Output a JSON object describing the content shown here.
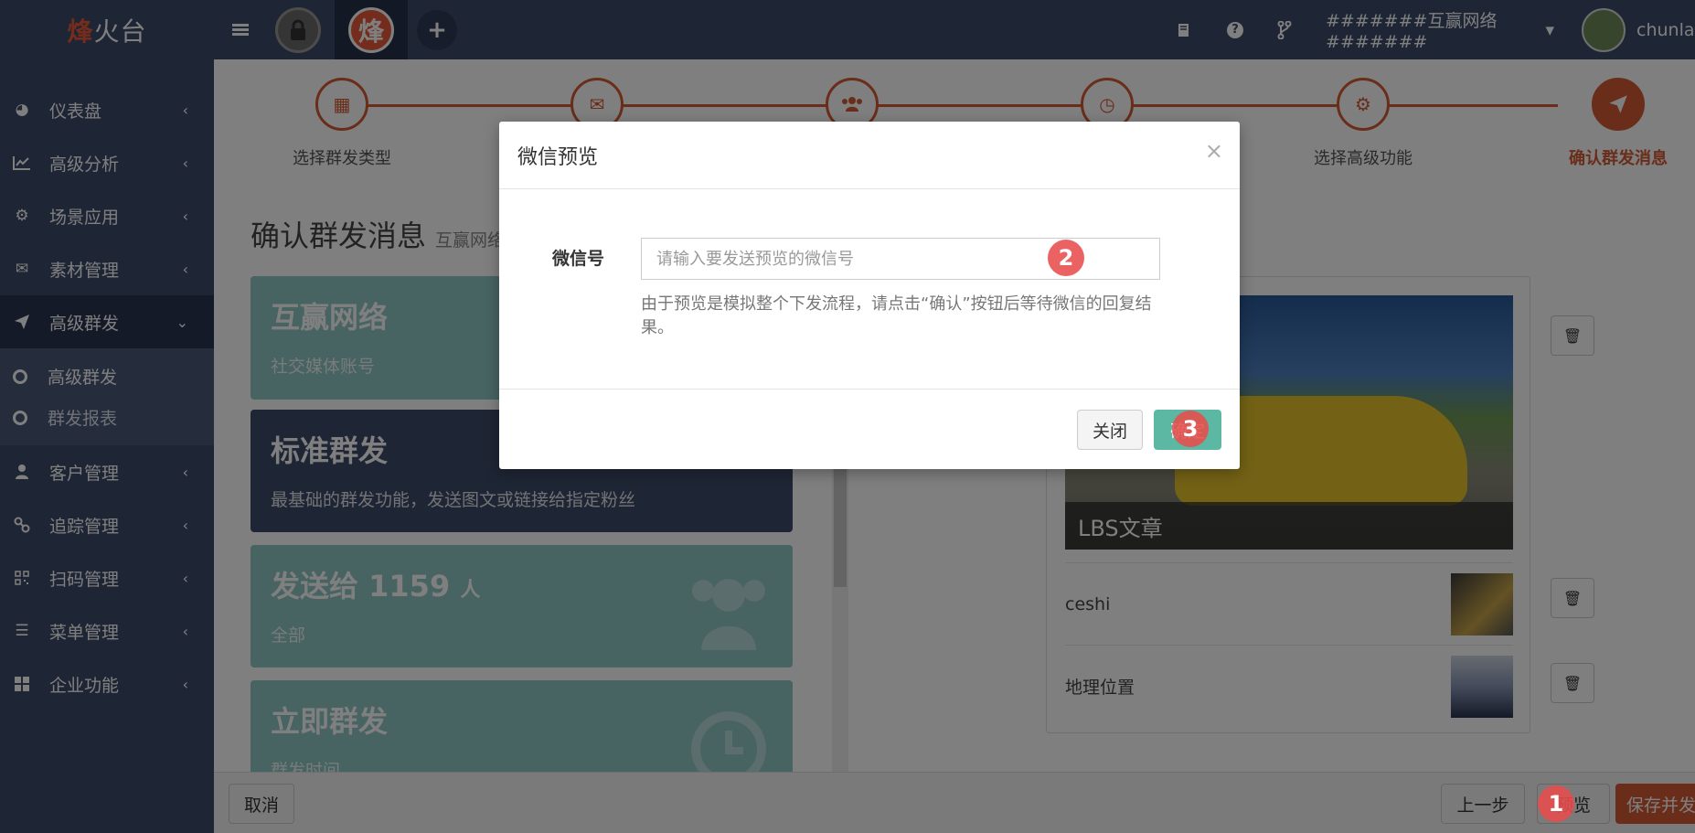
{
  "logo": {
    "part1": "烽",
    "part2": "火台"
  },
  "topbar": {
    "active_account_glyph": "烽",
    "add_glyph": "+",
    "account_menu": "#######互赢网络#######",
    "user_name": "chunlan",
    "icons": [
      "menu-icon",
      "book-icon",
      "help-icon",
      "branch-icon",
      "caret-down-icon"
    ]
  },
  "sidebar": {
    "items": [
      {
        "label": "仪表盘",
        "icon": "dashboard-icon"
      },
      {
        "label": "高级分析",
        "icon": "line-chart-icon"
      },
      {
        "label": "场景应用",
        "icon": "gear-icon"
      },
      {
        "label": "素材管理",
        "icon": "envelope-icon"
      },
      {
        "label": "高级群发",
        "icon": "send-icon"
      },
      {
        "label": "客户管理",
        "icon": "user-icon"
      },
      {
        "label": "追踪管理",
        "icon": "link-icon"
      },
      {
        "label": "扫码管理",
        "icon": "qrcode-icon"
      },
      {
        "label": "菜单管理",
        "icon": "list-icon"
      },
      {
        "label": "企业功能",
        "icon": "grid-icon"
      }
    ],
    "sub_items": [
      {
        "label": "高级群发"
      },
      {
        "label": "群发报表"
      }
    ]
  },
  "steps": [
    {
      "label": "选择群发类型",
      "icon": "grid-icon"
    },
    {
      "label": "",
      "icon": "envelope-icon"
    },
    {
      "label": "",
      "icon": "users-icon"
    },
    {
      "label": "",
      "icon": "clock-icon"
    },
    {
      "label": "选择高级功能",
      "icon": "gear-icon"
    },
    {
      "label": "确认群发消息",
      "icon": "send-icon"
    }
  ],
  "page": {
    "title": "确认群发消息",
    "subtitle": "互赢网络"
  },
  "cards": [
    {
      "title": "互赢网络",
      "subtitle": "社交媒体账号"
    },
    {
      "title": "标准群发",
      "subtitle": "最基础的群发功能，发送图文或链接给指定粉丝"
    },
    {
      "title": "发送给 1159",
      "title_unit": "人",
      "subtitle": "全部"
    },
    {
      "title": "立即群发",
      "subtitle": "群发时间"
    }
  ],
  "articles": {
    "cover_caption": "LBS文章",
    "items": [
      {
        "title": "ceshi"
      },
      {
        "title": "地理位置"
      }
    ]
  },
  "bottom_bar": {
    "cancel": "取消",
    "prev": "上一步",
    "preview": "预览",
    "save": "保存并发"
  },
  "modal": {
    "title": "微信预览",
    "close_glyph": "×",
    "field_label": "微信号",
    "input_placeholder": "请输入要发送预览的微信号",
    "input_value": "",
    "help_text": "由于预览是模拟整个下发流程，请点击“确认”按钮后等待微信的回复结果。",
    "close_button": "关闭",
    "confirm_button": "确定"
  },
  "markers": [
    "1",
    "2",
    "3"
  ],
  "colors": {
    "sidebar": "#3d4a68",
    "accent": "#d35a34",
    "teal": "#8fc6c4",
    "confirm": "#5cb8a3",
    "marker": "#e84c4c"
  }
}
